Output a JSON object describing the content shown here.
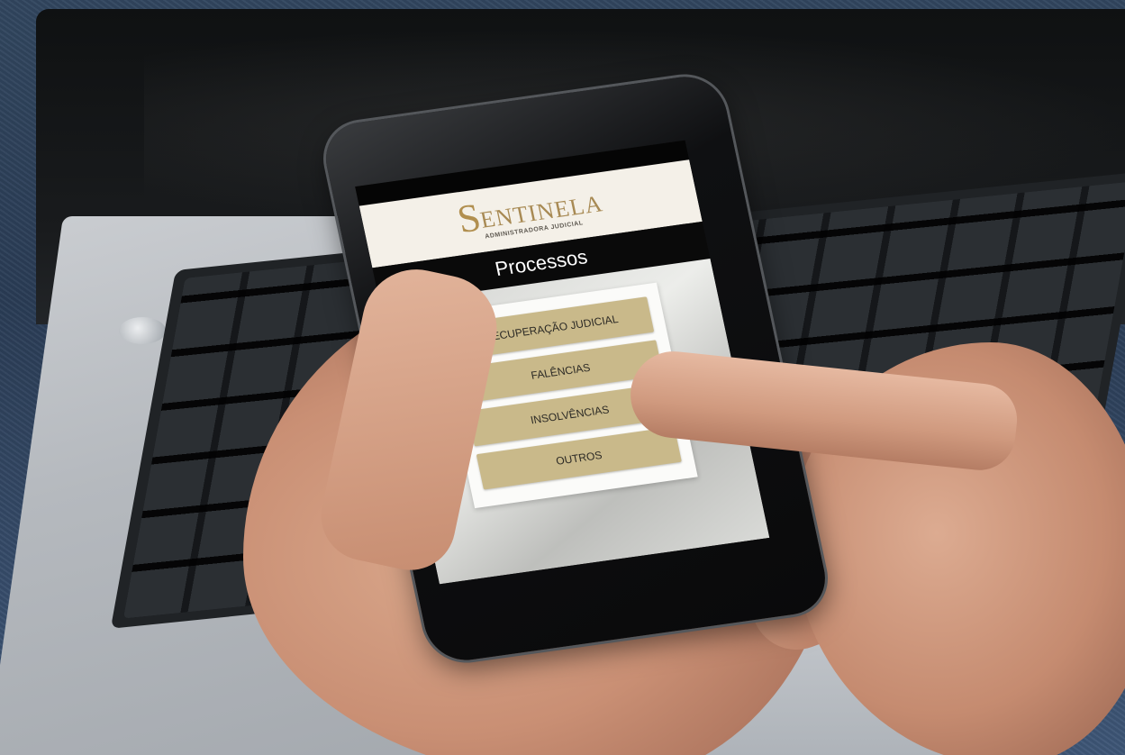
{
  "app": {
    "logo_letter": "S",
    "logo_text": "ENTINELA",
    "logo_subtitle": "ADMINISTRADORA JUDICIAL",
    "title": "Processos"
  },
  "menu": {
    "items": [
      {
        "label": "RECUPERAÇÃO JUDICIAL"
      },
      {
        "label": "FALÊNCIAS"
      },
      {
        "label": "INSOLVÊNCIAS"
      },
      {
        "label": "OUTROS"
      }
    ]
  },
  "colors": {
    "accent_gold": "#c9b98a",
    "logo_gold": "#a88a54",
    "title_bar": "#0a0a0a"
  }
}
